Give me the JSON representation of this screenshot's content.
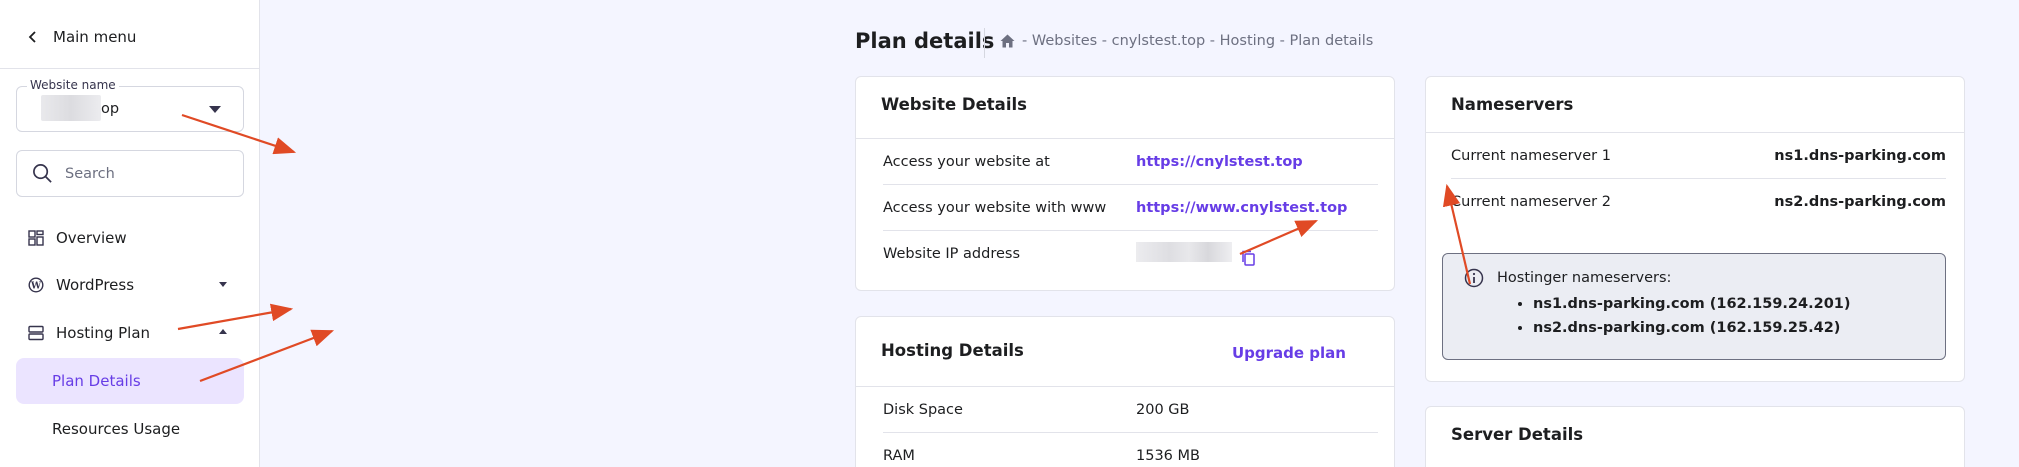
{
  "sidebar": {
    "main_menu_label": "Main menu",
    "website_select": {
      "label": "Website name",
      "value_visible": "op"
    },
    "search": {
      "placeholder": "Search"
    },
    "items": [
      {
        "label": "Overview",
        "icon": "grid-icon"
      },
      {
        "label": "WordPress",
        "icon": "wordpress-icon"
      },
      {
        "label": "Hosting Plan",
        "icon": "server-icon"
      },
      {
        "label": "Plan Details",
        "active": true
      },
      {
        "label": "Resources Usage"
      }
    ]
  },
  "header": {
    "title": "Plan details",
    "breadcrumb": "- Websites - cnylstest.top - Hosting - Plan details"
  },
  "website_details": {
    "title": "Website Details",
    "rows": [
      {
        "label": "Access your website at",
        "value": "https://cnylstest.top"
      },
      {
        "label": "Access your website with www",
        "value": "https://www.cnylstest.top"
      },
      {
        "label": "Website IP address"
      }
    ]
  },
  "hosting_details": {
    "title": "Hosting Details",
    "upgrade_label": "Upgrade plan",
    "rows": [
      {
        "label": "Disk Space",
        "value": "200 GB"
      },
      {
        "label": "RAM",
        "value": "1536 MB"
      }
    ]
  },
  "nameservers": {
    "title": "Nameservers",
    "rows": [
      {
        "label": "Current nameserver 1",
        "value": "ns1.dns-parking.com"
      },
      {
        "label": "Current nameserver 2",
        "value": "ns2.dns-parking.com"
      }
    ],
    "info": {
      "heading": "Hostinger nameservers:",
      "items": [
        "ns1.dns-parking.com (162.159.24.201)",
        "ns2.dns-parking.com (162.159.25.42)"
      ]
    }
  },
  "server_details": {
    "title": "Server Details"
  },
  "colors": {
    "accent": "#673de6",
    "active_bg": "#ebe4ff",
    "page_bg": "#f4f5ff",
    "annotation_arrow": "#e04a25"
  }
}
